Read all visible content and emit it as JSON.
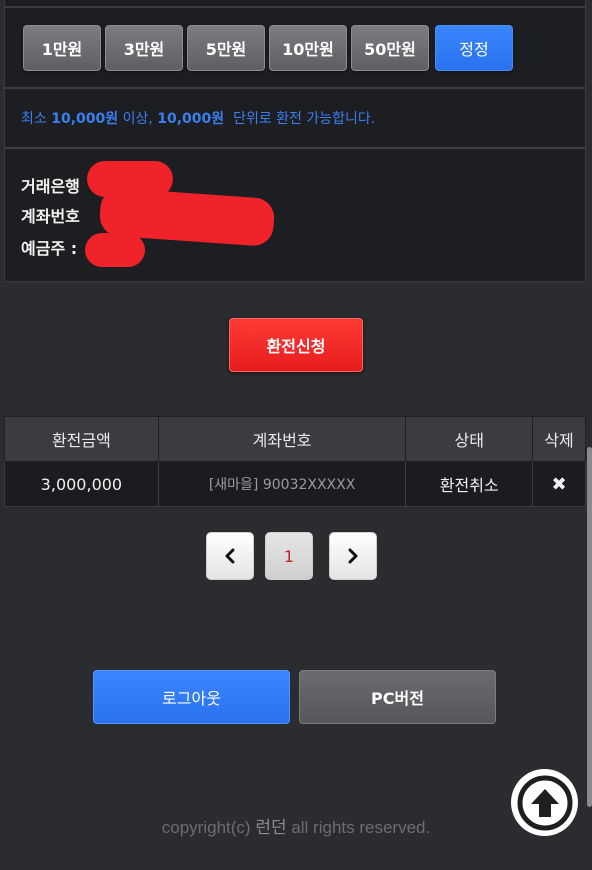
{
  "amount_buttons": [
    "1만원",
    "3만원",
    "5만원",
    "10만원",
    "50만원",
    "정정"
  ],
  "info": {
    "prefix": "최소",
    "min_amount": "10,000원",
    "mid": "이상,",
    "unit_amount": "10,000원",
    "suffix": "단위로 환전 가능합니다."
  },
  "bank": {
    "bank_label": "거래은행",
    "account_label": "계좌번호",
    "holder_label": "예금주 :"
  },
  "apply_label": "환전신청",
  "table": {
    "headers": [
      "환전금액",
      "계좌번호",
      "상태",
      "삭제"
    ],
    "rows": [
      {
        "amount": "3,000,000",
        "account": "[새마을] 90032XXXXX",
        "status": "환전취소",
        "delete": "✖"
      }
    ]
  },
  "pager": {
    "prev": "‹",
    "current": "1",
    "next": "›"
  },
  "logout_label": "로그아웃",
  "pc_label": "PC버전",
  "copyright": {
    "prefix": "copyright(c)",
    "brand": "런던",
    "suffix": "all rights reserved."
  },
  "colors": {
    "accent_blue": "#2a7bf6",
    "danger_red": "#f02a28",
    "background": "#2b2c30"
  },
  "icons": {
    "prev": "chevron-left-icon",
    "next": "chevron-right-icon",
    "scroll_top": "arrow-up-circle-icon",
    "delete": "close-icon"
  }
}
